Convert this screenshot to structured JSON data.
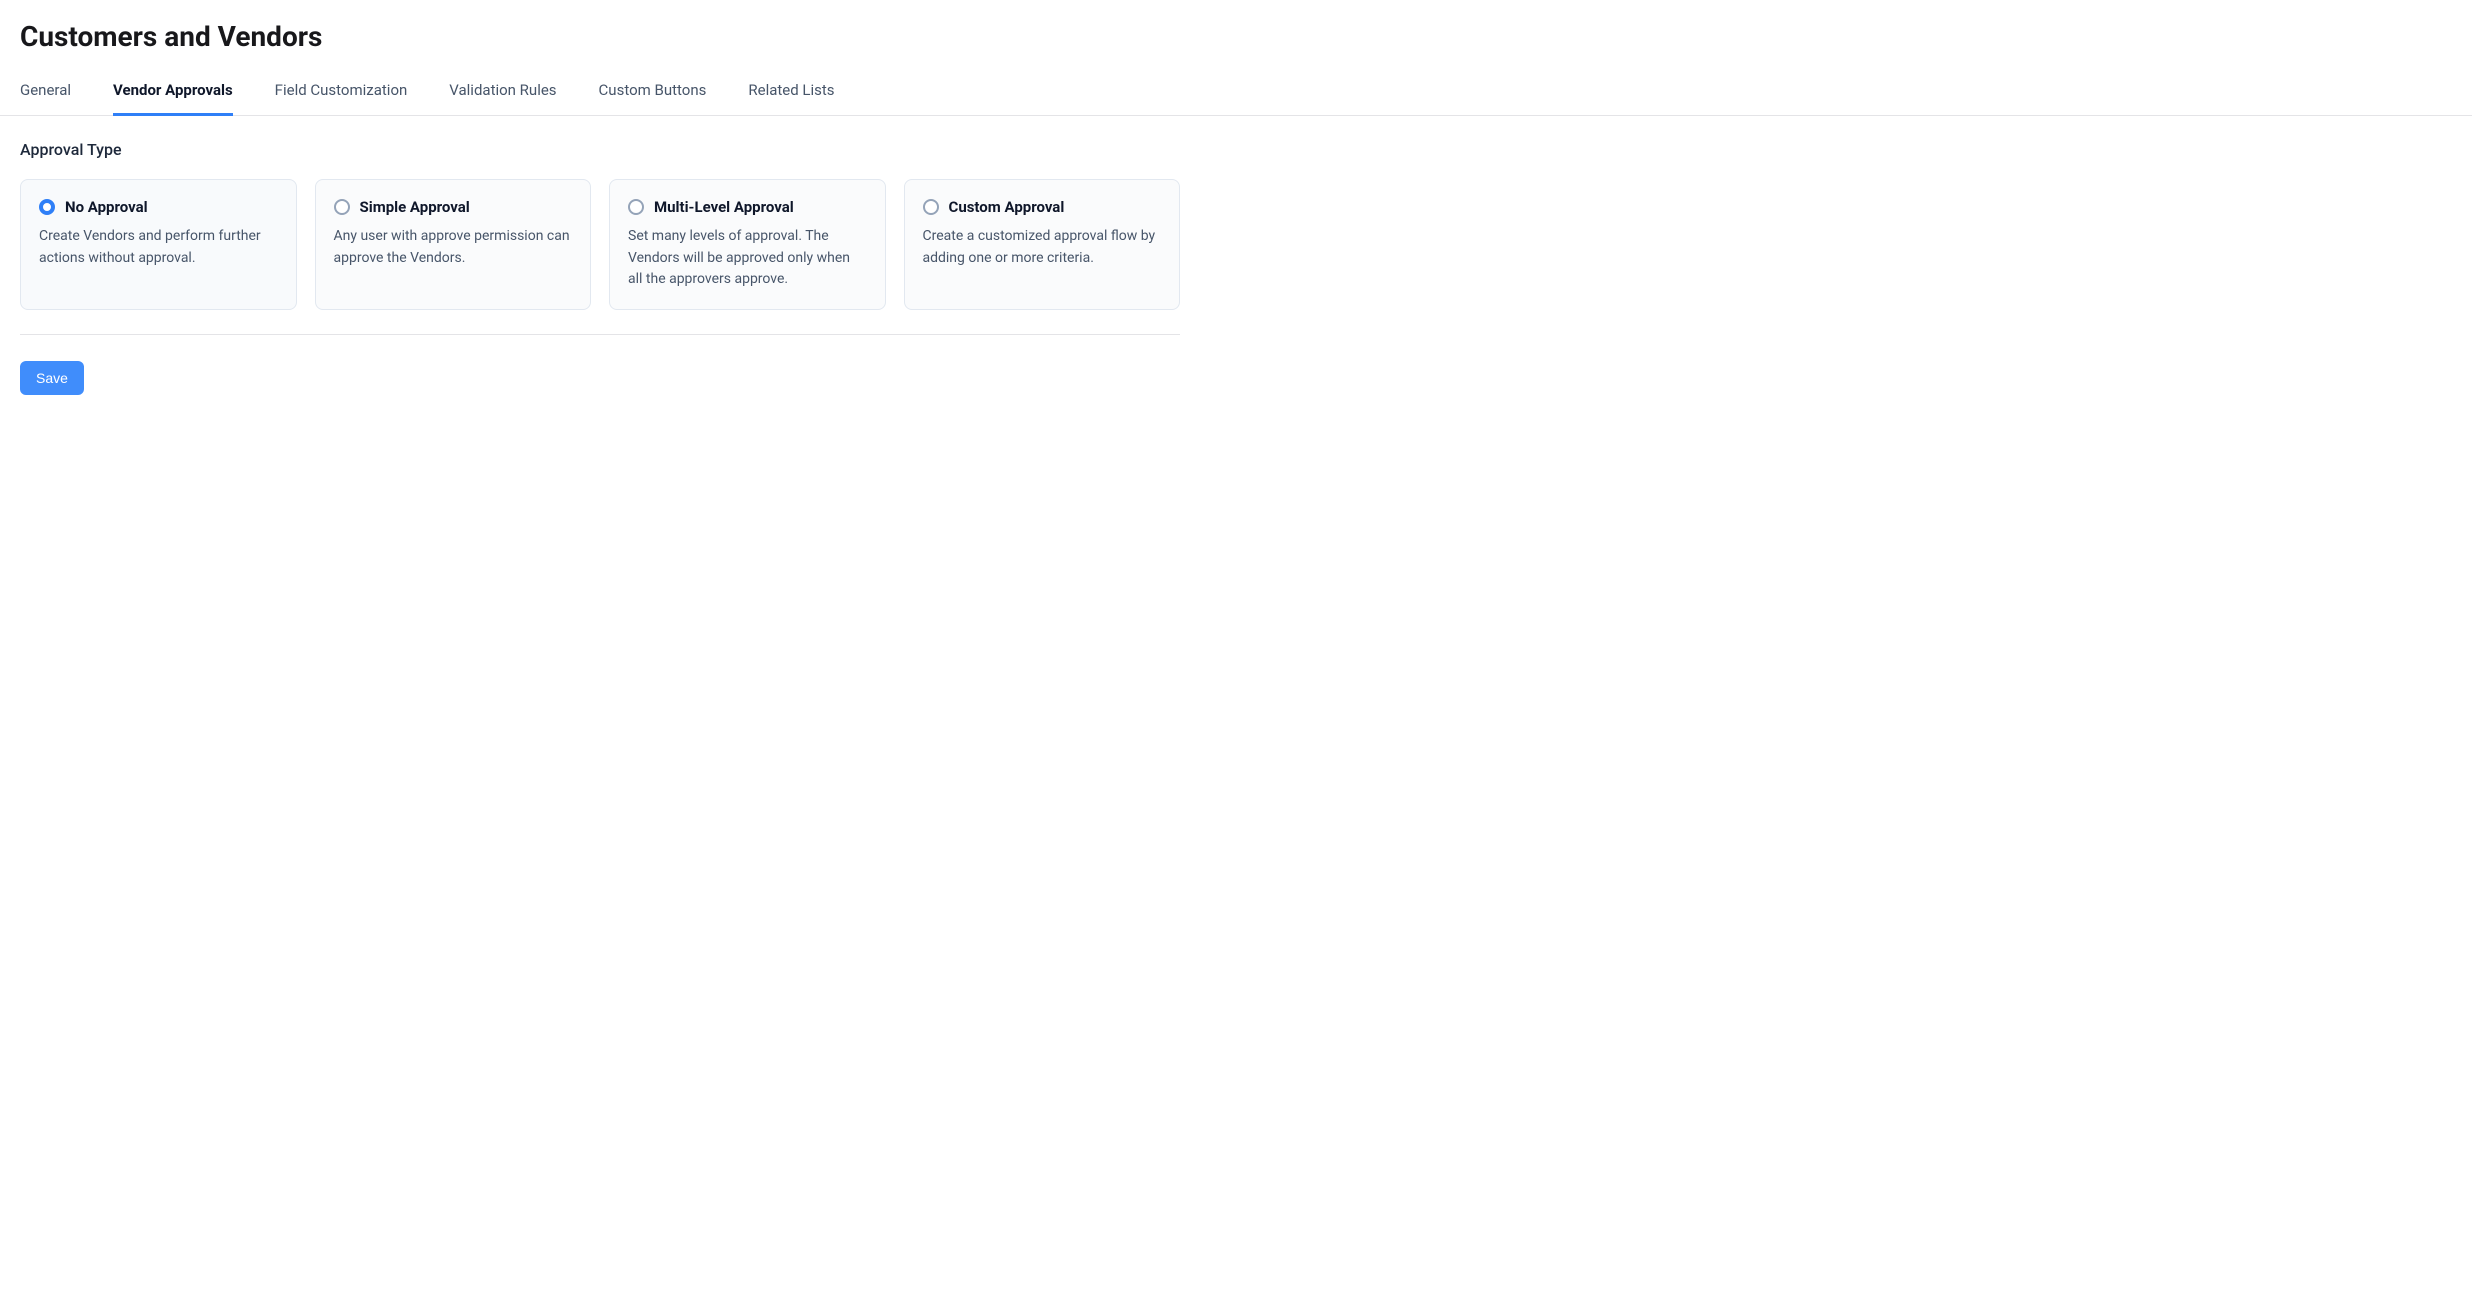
{
  "header": {
    "title": "Customers and Vendors"
  },
  "tabs": [
    {
      "label": "General",
      "active": false
    },
    {
      "label": "Vendor Approvals",
      "active": true
    },
    {
      "label": "Field Customization",
      "active": false
    },
    {
      "label": "Validation Rules",
      "active": false
    },
    {
      "label": "Custom Buttons",
      "active": false
    },
    {
      "label": "Related Lists",
      "active": false
    }
  ],
  "section": {
    "label": "Approval Type"
  },
  "options": [
    {
      "title": "No Approval",
      "desc": "Create Vendors and perform further actions without approval.",
      "selected": true
    },
    {
      "title": "Simple Approval",
      "desc": "Any user with approve permission can approve the Vendors.",
      "selected": false
    },
    {
      "title": "Multi-Level Approval",
      "desc": "Set many levels of approval. The Vendors will be approved only when all the approvers approve.",
      "selected": false
    },
    {
      "title": "Custom Approval",
      "desc": "Create a customized approval flow by adding one or more criteria.",
      "selected": false
    }
  ],
  "buttons": {
    "save": "Save"
  },
  "colors": {
    "accent": "#408dfb",
    "text": "#18181b",
    "muted": "#475569",
    "border": "#e2e8f0"
  }
}
